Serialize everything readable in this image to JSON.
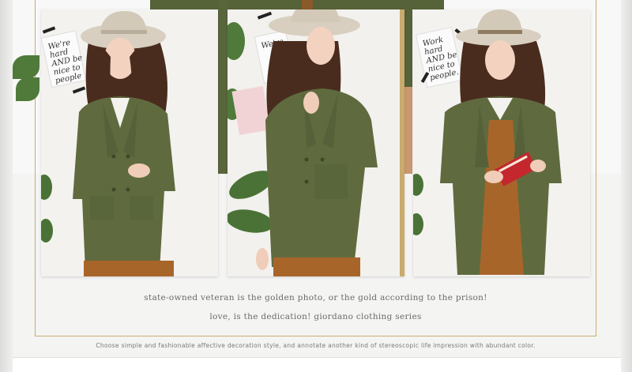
{
  "captions": {
    "line1": "state-owned veteran is the golden photo, or the gold according to the prison!",
    "line2": "love, is the dedication! giordano clothing series",
    "line3": "Choose simple and fashionable affective decoration style, and annotate another kind of stereoscopic life impression with abundant color."
  },
  "photos": [
    {
      "sign_lines": [
        "We're",
        "hard",
        "AND be",
        "nice to",
        "people"
      ]
    },
    {
      "sign_lines": [
        "We're"
      ]
    },
    {
      "sign_lines": [
        "Work",
        "hard",
        "AND be",
        "nice to",
        "people."
      ]
    }
  ],
  "colors": {
    "coat": "#5f6b3e",
    "hat": "#d8cfc0",
    "hair": "#4a2c1f",
    "gold_frame": "#c9ab6e",
    "book": "#c4272e"
  }
}
